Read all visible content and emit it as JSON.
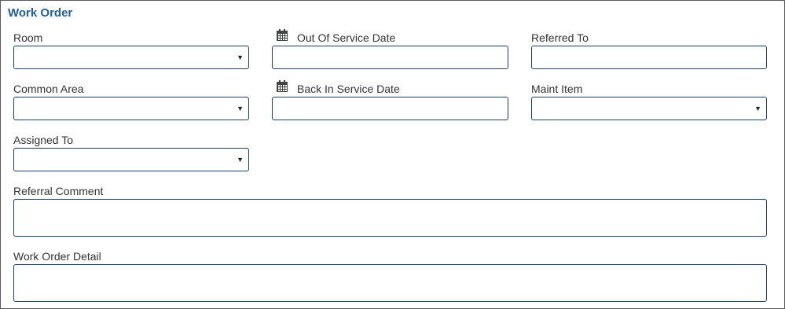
{
  "form": {
    "title": "Work Order",
    "room": {
      "label": "Room",
      "value": ""
    },
    "out_of_service_date": {
      "label": "Out Of Service Date",
      "value": "",
      "icon": "calendar-icon"
    },
    "referred_to": {
      "label": "Referred To",
      "value": ""
    },
    "common_area": {
      "label": "Common Area",
      "value": ""
    },
    "back_in_service_date": {
      "label": "Back In Service Date",
      "value": "",
      "icon": "calendar-icon"
    },
    "maint_item": {
      "label": "Maint Item",
      "value": ""
    },
    "assigned_to": {
      "label": "Assigned To",
      "value": ""
    },
    "referral_comment": {
      "label": "Referral Comment",
      "value": ""
    },
    "work_order_detail": {
      "label": "Work Order Detail",
      "value": ""
    },
    "dropdown_arrow": "▼"
  },
  "colors": {
    "title": "#1f5e96",
    "field_border": "#1f3f66"
  }
}
